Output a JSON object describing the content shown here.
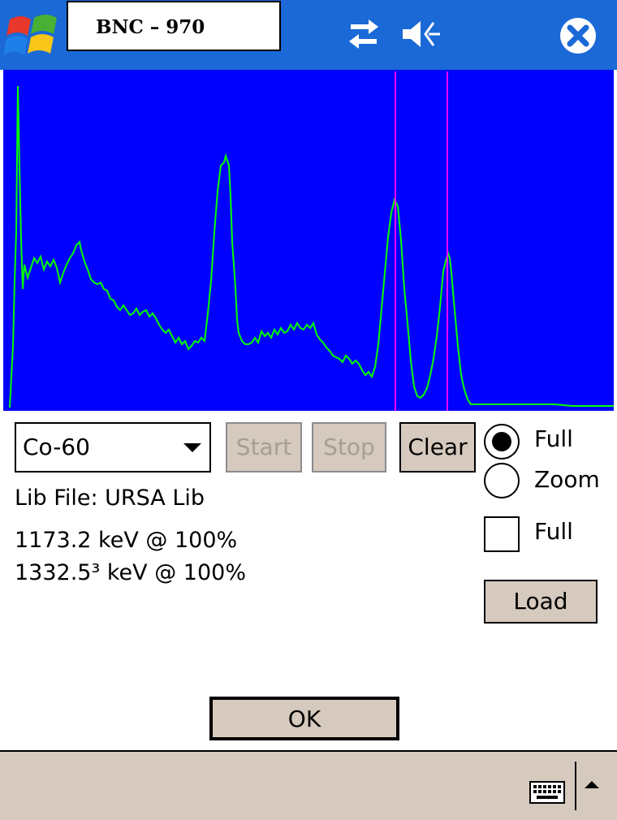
{
  "titlebar": {
    "title": "BNC – 970",
    "icons": [
      "windows-logo-icon",
      "connectivity-icon",
      "volume-icon",
      "close-icon"
    ],
    "background_color": "#1a69d6"
  },
  "spectrum": {
    "background_color": "#0000ff",
    "trace_color": "#00ff00",
    "marker_color": "#ff00ff",
    "marker_count": 2
  },
  "form": {
    "isotope_select": {
      "value": "Co-60"
    },
    "buttons": {
      "start": "Start",
      "stop": "Stop",
      "clear": "Clear",
      "load": "Load",
      "ok": "OK"
    },
    "view_mode": {
      "options": [
        "Full",
        "Zoom"
      ],
      "selected": "Full"
    },
    "full_checkbox": {
      "label": "Full",
      "checked": false
    },
    "lib_file": "Lib File: URSA Lib",
    "lines": [
      "1173.2 keV @ 100%",
      "1332.5³ keV @ 100%"
    ]
  },
  "menubar": {
    "background_color": "#d6c9be",
    "icons": [
      "keyboard-icon",
      "sip-arrow-up-icon"
    ]
  }
}
